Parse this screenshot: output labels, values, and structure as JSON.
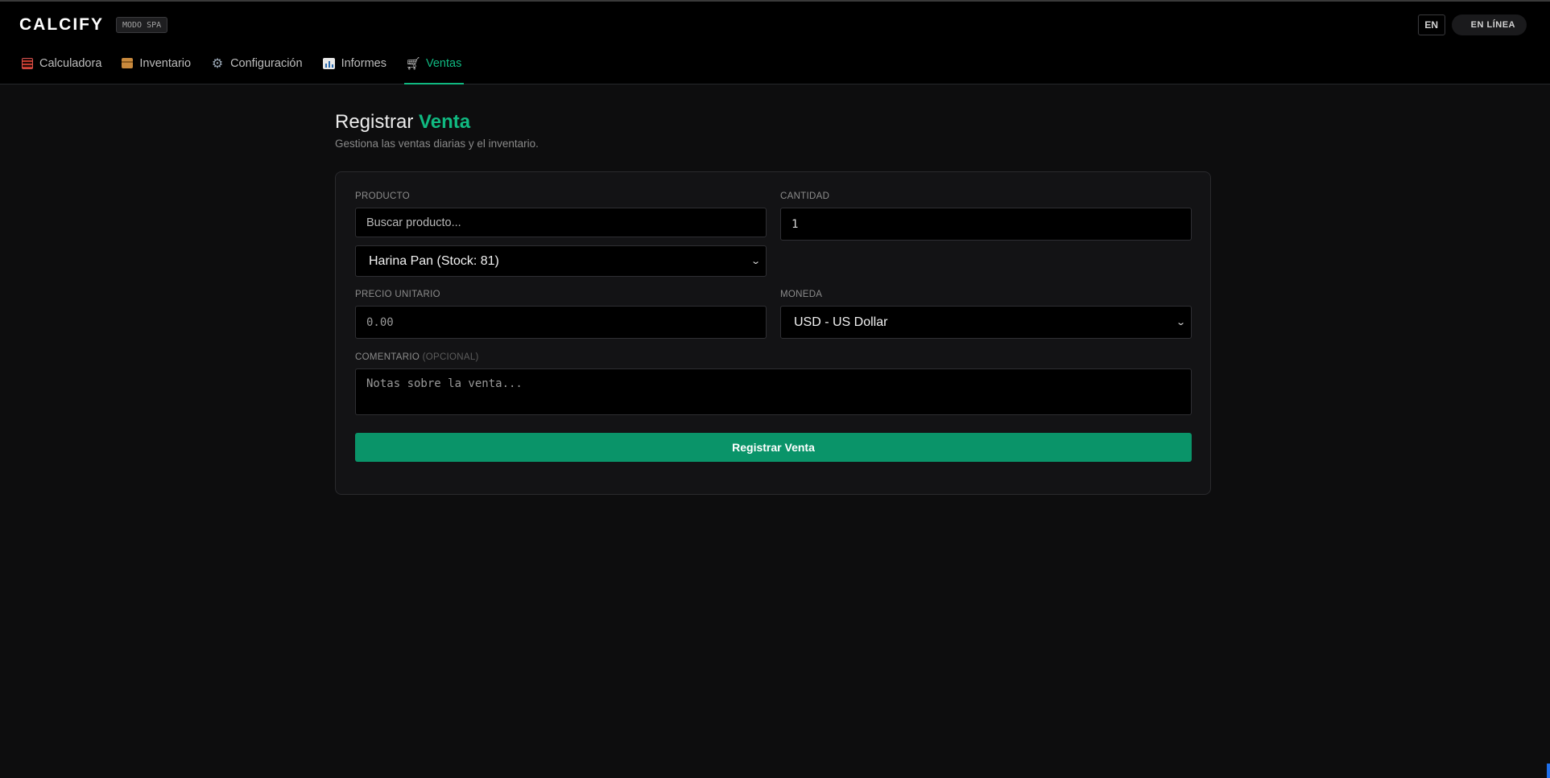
{
  "header": {
    "logo": "CALCIFY",
    "mode_badge": "MODO SPA",
    "language_button": "EN",
    "status": "EN LÍNEA"
  },
  "nav": {
    "tabs": [
      {
        "label": "Calculadora",
        "icon": "calculator-icon"
      },
      {
        "label": "Inventario",
        "icon": "package-icon"
      },
      {
        "label": "Configuración",
        "icon": "gear-icon"
      },
      {
        "label": "Informes",
        "icon": "bar-chart-icon"
      },
      {
        "label": "Ventas",
        "icon": "shopping-cart-icon",
        "active": true
      }
    ]
  },
  "page": {
    "title_prefix": "Registrar",
    "title_accent": "Venta",
    "subtitle": "Gestiona las ventas diarias y el inventario."
  },
  "form": {
    "product_label": "PRODUCTO",
    "product_search_placeholder": "Buscar producto...",
    "product_selected": "Harina Pan (Stock: 81)",
    "quantity_label": "CANTIDAD",
    "quantity_value": "1",
    "unit_price_label": "PRECIO UNITARIO",
    "unit_price_placeholder": "0.00",
    "currency_label": "MONEDA",
    "currency_selected": "USD - US Dollar",
    "comment_label": "COMENTARIO",
    "comment_optional": "(OPCIONAL)",
    "comment_placeholder": "Notas sobre la venta...",
    "submit_label": "Registrar Venta"
  },
  "colors": {
    "accent": "#10b981",
    "submit_bg": "#0a9469",
    "background": "#0d0d0e",
    "header_bg": "#000000"
  }
}
